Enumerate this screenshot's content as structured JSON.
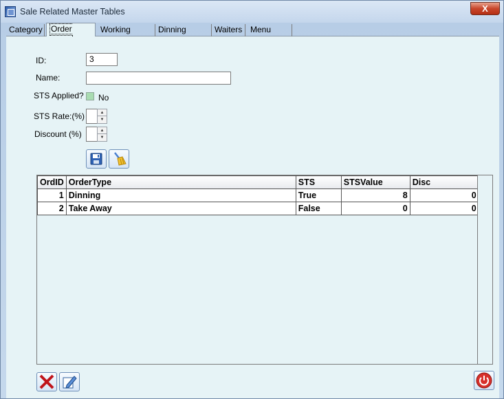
{
  "window": {
    "title": "Sale Related Master Tables",
    "close_label": "X"
  },
  "tabs": [
    {
      "label": "Category",
      "active": false
    },
    {
      "label": "Order Types",
      "active": true
    },
    {
      "label": "Working Shifts",
      "active": false
    },
    {
      "label": "Dinning Tables",
      "active": false
    },
    {
      "label": "Waiters",
      "active": false
    },
    {
      "label": "Menu Items",
      "active": false
    }
  ],
  "form": {
    "id_label": "ID:",
    "id_value": "3",
    "name_label": "Name:",
    "name_value": "",
    "sts_applied_label": "STS Applied?",
    "sts_applied_value": "No",
    "sts_rate_label": "STS Rate:(%)",
    "sts_rate_value": "",
    "discount_label": "Discount (%)",
    "discount_value": ""
  },
  "icons": {
    "save": "floppy-disk-icon",
    "clear": "broom-icon",
    "delete": "red-x-icon",
    "edit": "pencil-icon",
    "power": "power-icon"
  },
  "grid": {
    "columns": [
      "OrdID",
      "OrderType",
      "STS",
      "STSValue",
      "Disc"
    ],
    "rows": [
      {
        "id": "1",
        "type": "Dinning",
        "sts": "True",
        "sts_value": "8",
        "disc": "0"
      },
      {
        "id": "2",
        "type": "Take Away",
        "sts": "False",
        "sts_value": "0",
        "disc": "0"
      }
    ]
  }
}
